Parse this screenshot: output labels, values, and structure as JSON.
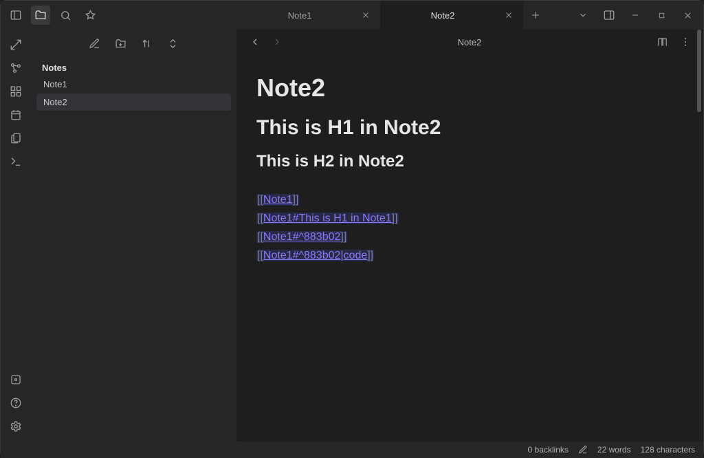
{
  "titlebar": {
    "tabs": [
      {
        "title": "Note1",
        "active": false
      },
      {
        "title": "Note2",
        "active": true
      }
    ]
  },
  "sidebar": {
    "header": "Notes",
    "files": [
      {
        "name": "Note1",
        "selected": false
      },
      {
        "name": "Note2",
        "selected": true
      }
    ]
  },
  "editor": {
    "breadcrumb": "Note2",
    "inline_title": "Note2",
    "h1": "This is H1 in Note2",
    "h2": "This is H2 in Note2",
    "links": [
      {
        "text": "Note1"
      },
      {
        "text": "Note1#This is H1 in Note1"
      },
      {
        "text": "Note1#^883b02"
      },
      {
        "text": "Note1#^883b02|code"
      }
    ]
  },
  "status": {
    "backlinks": "0 backlinks",
    "words": "22 words",
    "chars": "128 characters"
  }
}
